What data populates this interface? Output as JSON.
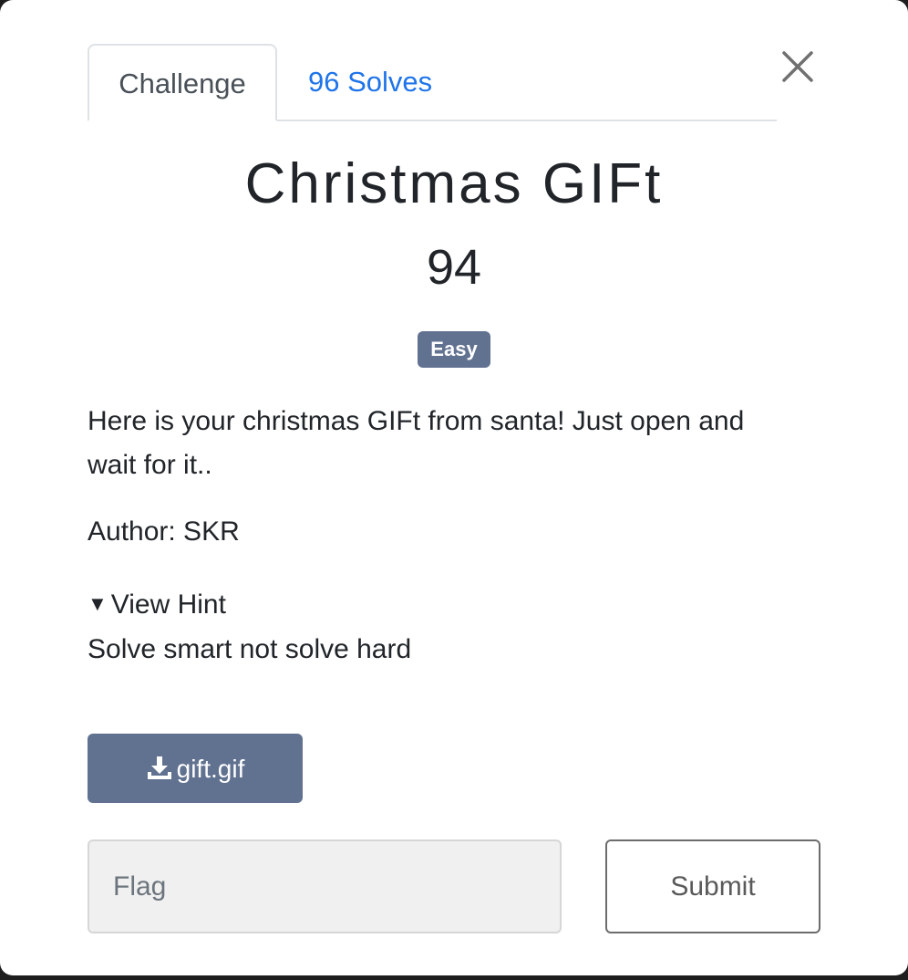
{
  "tabs": {
    "challenge": "Challenge",
    "solves": "96 Solves"
  },
  "challenge": {
    "title": "Christmas GIFt",
    "points": "94",
    "difficulty": "Easy",
    "description": "Here is your christmas GIFt from santa! Just open and wait for it..",
    "author": "Author: SKR"
  },
  "hint": {
    "toggle_label": "View Hint",
    "text": "Solve smart not solve hard"
  },
  "file": {
    "name": "gift.gif",
    "icon": "download-icon"
  },
  "flag": {
    "placeholder": "Flag",
    "value": "",
    "submit_label": "Submit"
  },
  "colors": {
    "accent_link": "#1f74e9",
    "badge": "#617190",
    "button": "#617190"
  }
}
